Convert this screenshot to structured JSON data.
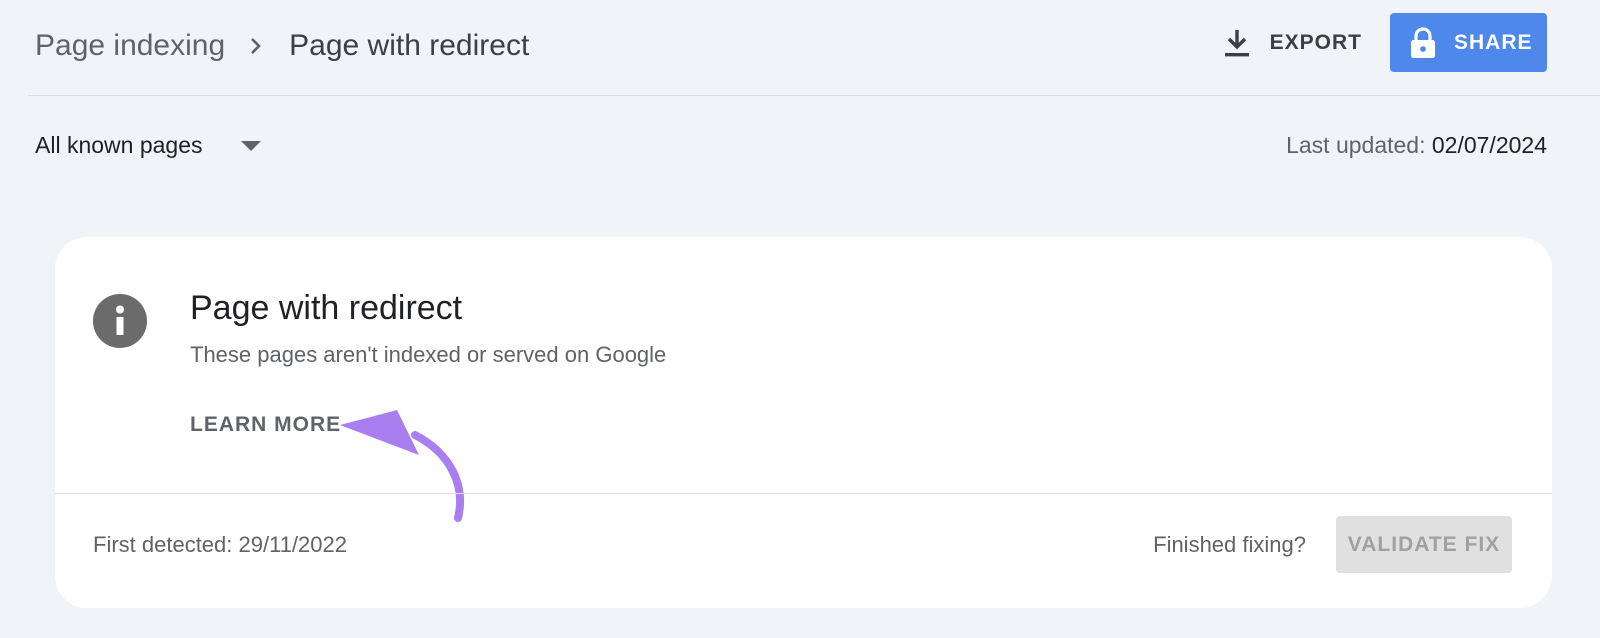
{
  "header": {
    "breadcrumb_root": "Page indexing",
    "breadcrumb_current": "Page with redirect",
    "export_label": "EXPORT",
    "share_label": "SHARE"
  },
  "filter": {
    "selected": "All known pages"
  },
  "last_updated": {
    "label": "Last updated:",
    "value": "02/07/2024"
  },
  "card": {
    "icon": "info-icon",
    "title": "Page with redirect",
    "subtitle": "These pages aren't indexed or served on Google",
    "learn_more": "LEARN MORE",
    "first_detected": "First detected: 29/11/2022",
    "finished_prompt": "Finished fixing?",
    "validate_label": "VALIDATE FIX"
  },
  "colors": {
    "background": "#f0f4f9",
    "share_button": "#4e88eb",
    "annotation_arrow": "#a97ff0"
  }
}
